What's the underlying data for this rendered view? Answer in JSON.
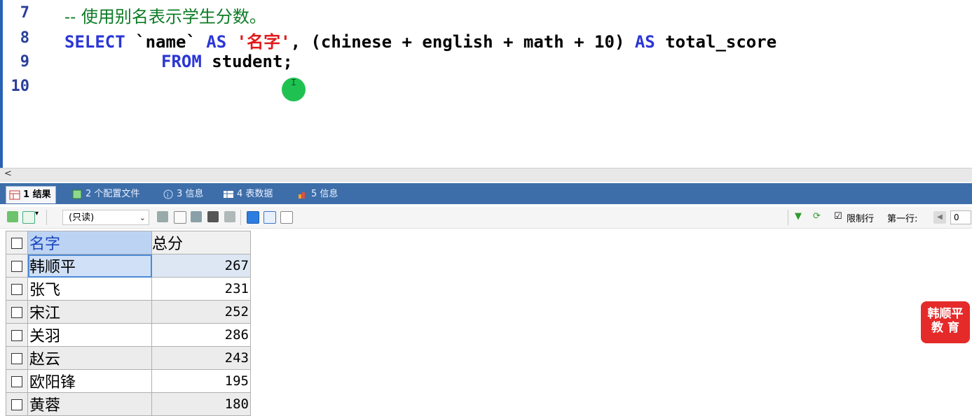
{
  "editor": {
    "lines": [
      {
        "num": "7",
        "comment": "-- 使用别名表示学生分数。"
      },
      {
        "num": "8",
        "select": "SELECT",
        "col": " `name` ",
        "as1": "AS",
        "alias": " '名字'",
        "rest": ", (chinese + english + math + 10) ",
        "as2": "AS",
        "tail": " total_score"
      },
      {
        "num": "9",
        "from": "FROM",
        "table": " student;"
      },
      {
        "num": "10"
      }
    ],
    "cursor_glyph": "I"
  },
  "tabs": [
    {
      "label": "1 结果",
      "active": true
    },
    {
      "label": "2 个配置文件"
    },
    {
      "label": "3 信息"
    },
    {
      "label": "4 表数据"
    },
    {
      "label": "5 信息"
    }
  ],
  "toolbar": {
    "mode_select": "(只读)",
    "limit_rows_label": "限制行",
    "first_row_label": "第一行:",
    "first_row_value": "0"
  },
  "grid": {
    "columns": [
      "名字",
      "总分"
    ],
    "rows": [
      {
        "name": "韩顺平",
        "score": "267"
      },
      {
        "name": "张飞",
        "score": "231"
      },
      {
        "name": "宋江",
        "score": "252"
      },
      {
        "name": "关羽",
        "score": "286"
      },
      {
        "name": "赵云",
        "score": "243"
      },
      {
        "name": "欧阳锋",
        "score": "195"
      },
      {
        "name": "黄蓉",
        "score": "180"
      }
    ]
  },
  "watermark": {
    "line1": "韩顺平",
    "line2": "教 育"
  },
  "colors": {
    "tab_bar": "#3d6ea9",
    "keyword": "#2a36d6",
    "comment": "#0c7b24",
    "string": "#e01a1a",
    "watermark": "#e52a2a"
  }
}
